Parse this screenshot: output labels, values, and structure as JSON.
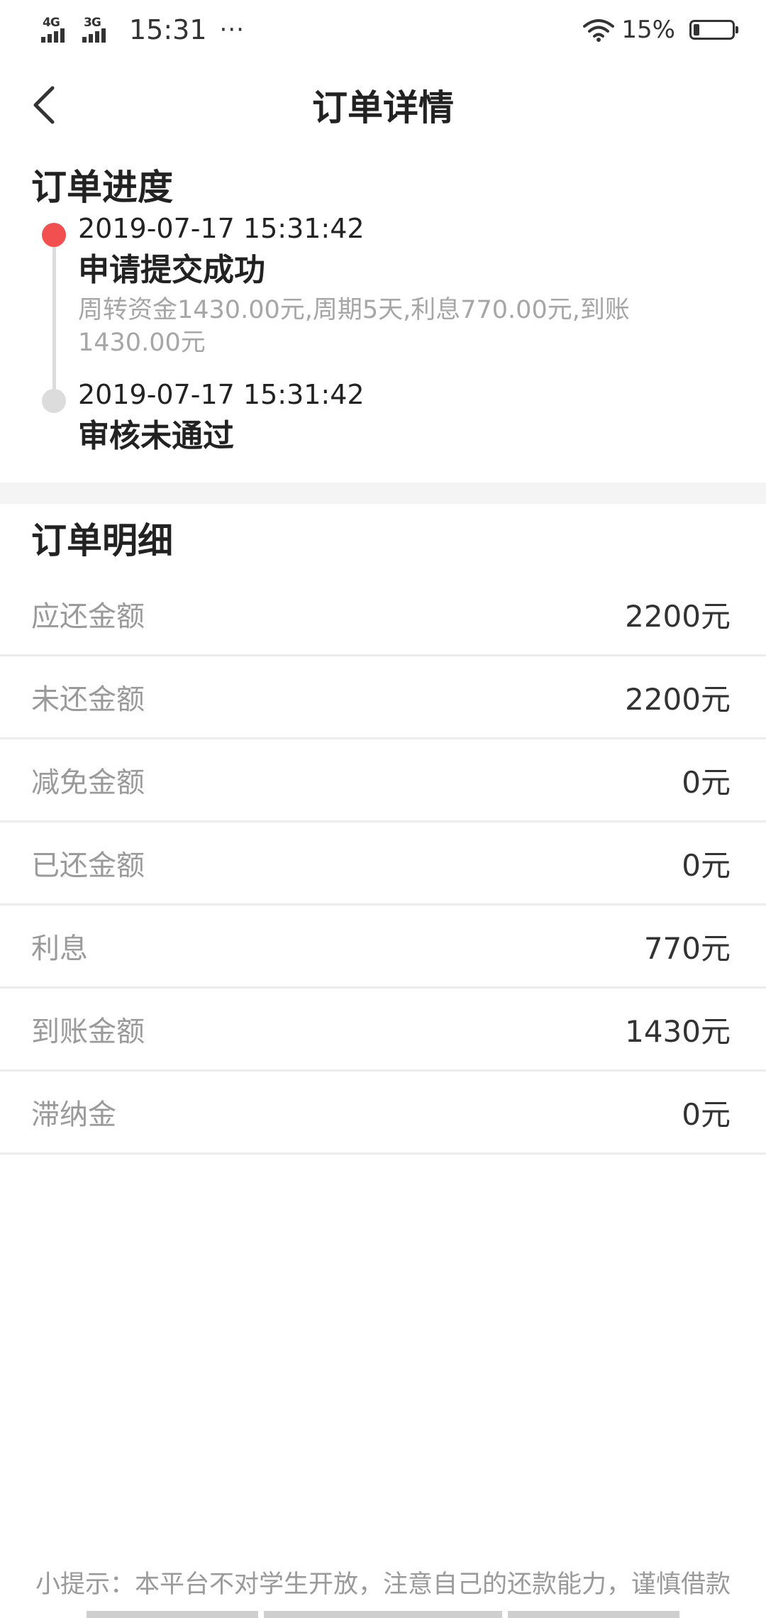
{
  "status_bar": {
    "network1": "4G",
    "network2": "3G",
    "time": "15:31",
    "more": "···",
    "battery_text": "15%",
    "battery_level": 0.15
  },
  "header": {
    "title": "订单详情"
  },
  "progress": {
    "section_title": "订单进度",
    "items": [
      {
        "time": "2019-07-17 15:31:42",
        "title": "申请提交成功",
        "desc": "周转资金1430.00元,周期5天,利息770.00元,到账1430.00元"
      },
      {
        "time": "2019-07-17 15:31:42",
        "title": "审核未通过"
      }
    ]
  },
  "details": {
    "section_title": "订单明细",
    "rows": [
      {
        "label": "应还金额",
        "value": "2200元"
      },
      {
        "label": "未还金额",
        "value": "2200元"
      },
      {
        "label": "减免金额",
        "value": "0元"
      },
      {
        "label": "已还金额",
        "value": "0元"
      },
      {
        "label": "利息",
        "value": "770元"
      },
      {
        "label": "到账金额",
        "value": "1430元"
      },
      {
        "label": "滞纳金",
        "value": "0元"
      }
    ]
  },
  "footer": {
    "tip": "小提示：本平台不对学生开放，注意自己的还款能力，谨慎借款"
  },
  "colors": {
    "active_dot": "#f25050",
    "inactive_dot": "#dcdcdc"
  }
}
